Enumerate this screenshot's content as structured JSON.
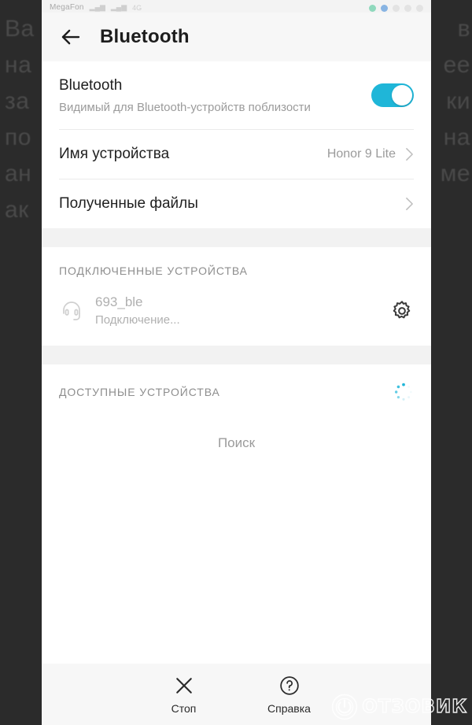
{
  "backdrop": {
    "left_text_fragments": [
      "Ва",
      "на",
      "за",
      "по",
      "ан",
      "ак"
    ],
    "right_text_fragments": [
      "в",
      "ее",
      "ки",
      "на",
      "ме"
    ],
    "background_color": "#2b2b2b"
  },
  "statusbar": {
    "carrier": "MegaFon",
    "signal_label": "4G",
    "icons": [
      "signal-bars-icon",
      "signal-bars-icon",
      "network-type-icon",
      "whatsapp-icon",
      "messenger-icon",
      "alarm-icon",
      "mute-icon",
      "battery-icon"
    ],
    "time": ""
  },
  "appbar": {
    "back_icon": "back-arrow-icon",
    "title": "Bluetooth"
  },
  "bluetooth": {
    "title": "Bluetooth",
    "subtitle": "Видимый для Bluetooth-устройств поблизости",
    "enabled": true,
    "accent_color": "#1fb6d8"
  },
  "rows": [
    {
      "label": "Имя устройства",
      "value": "Honor 9 Lite",
      "chevron": "chevron-right-icon"
    },
    {
      "label": "Полученные файлы",
      "value": "",
      "chevron": "chevron-right-icon"
    }
  ],
  "paired_section": {
    "header": "ПОДКЛЮЧЕННЫЕ УСТРОЙСТВА",
    "devices": [
      {
        "icon": "headphones-icon",
        "name": "693_ble",
        "status": "Подключение...",
        "settings_icon": "gear-icon"
      }
    ]
  },
  "available_section": {
    "header": "ДОСТУПНЫЕ УСТРОЙСТВА",
    "spinner_icon": "loading-spinner-icon",
    "spinner_color": "#1fb6d8",
    "searching_label": "Поиск"
  },
  "toolbar": {
    "buttons": [
      {
        "icon": "close-x-icon",
        "label": "Стоп"
      },
      {
        "icon": "question-circle-icon",
        "label": "Справка"
      }
    ]
  },
  "watermark": {
    "logo_icon": "power-button-logo-icon",
    "text": "ОТЗОВИК"
  }
}
